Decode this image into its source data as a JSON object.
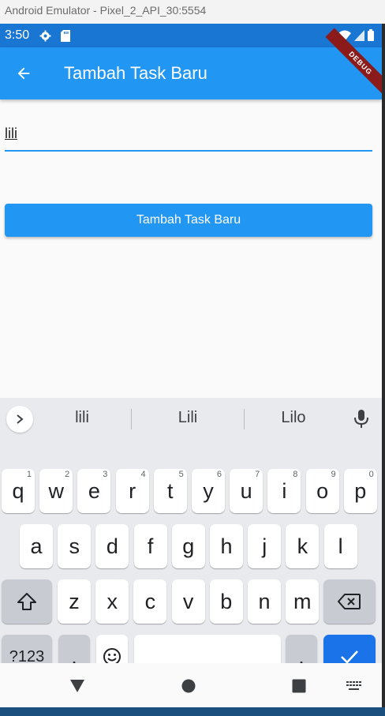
{
  "window": {
    "title": "Android Emulator - Pixel_2_API_30:5554"
  },
  "status_bar": {
    "time": "3:50"
  },
  "debug_banner": "DEBUG",
  "app_bar": {
    "title": "Tambah Task Baru"
  },
  "form": {
    "task_input_value": "lili",
    "submit_label": "Tambah Task Baru"
  },
  "keyboard": {
    "suggestions": [
      "lili",
      "Lili",
      "Lilo"
    ],
    "row1": [
      {
        "k": "q",
        "h": "1"
      },
      {
        "k": "w",
        "h": "2"
      },
      {
        "k": "e",
        "h": "3"
      },
      {
        "k": "r",
        "h": "4"
      },
      {
        "k": "t",
        "h": "5"
      },
      {
        "k": "y",
        "h": "6"
      },
      {
        "k": "u",
        "h": "7"
      },
      {
        "k": "i",
        "h": "8"
      },
      {
        "k": "o",
        "h": "9"
      },
      {
        "k": "p",
        "h": "0"
      }
    ],
    "row2": [
      "a",
      "s",
      "d",
      "f",
      "g",
      "h",
      "j",
      "k",
      "l"
    ],
    "row3": [
      "z",
      "x",
      "c",
      "v",
      "b",
      "n",
      "m"
    ],
    "symbols_label": "?123",
    "comma": ",",
    "period": "."
  },
  "colors": {
    "primary": "#2196f3",
    "status_bar": "#1976d2",
    "enter_key": "#1a73e8"
  }
}
